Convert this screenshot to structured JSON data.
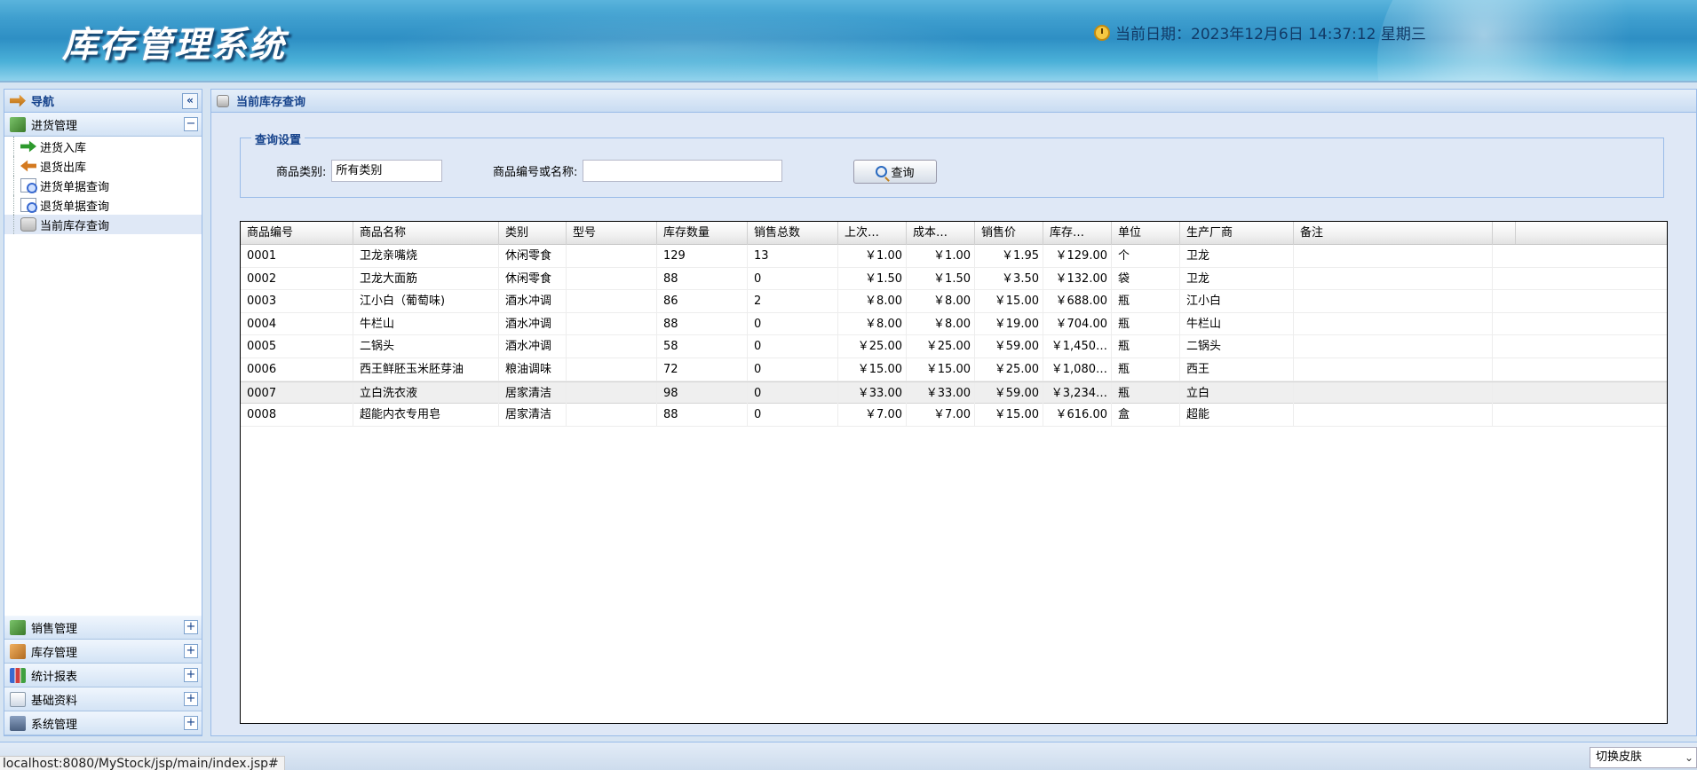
{
  "header": {
    "app_title": "库存管理系统",
    "datetime": "当前日期：2023年12月6日 14:37:12 星期三",
    "clock_icon": "clock-icon"
  },
  "nav": {
    "title": "导航",
    "collapse_glyph": "«",
    "expanded_group": {
      "label": "进货管理",
      "toggle": "−",
      "items": [
        {
          "label": "进货入库",
          "icon": "stock-in-icon"
        },
        {
          "label": "退货出库",
          "icon": "stock-out-icon"
        },
        {
          "label": "进货单据查询",
          "icon": "document-search-icon"
        },
        {
          "label": "退货单据查询",
          "icon": "document-search-icon"
        },
        {
          "label": "当前库存查询",
          "icon": "database-icon",
          "active": true
        }
      ]
    },
    "groups": [
      {
        "label": "销售管理",
        "toggle": "+"
      },
      {
        "label": "库存管理",
        "toggle": "+"
      },
      {
        "label": "统计报表",
        "toggle": "+"
      },
      {
        "label": "基础资料",
        "toggle": "+"
      },
      {
        "label": "系统管理",
        "toggle": "+"
      }
    ]
  },
  "main": {
    "title": "当前库存查询",
    "query": {
      "legend": "查询设置",
      "category_label": "商品类别:",
      "category_value": "所有类别",
      "keyword_label": "商品编号或名称:",
      "keyword_value": "",
      "button_label": "查询"
    },
    "grid": {
      "columns": [
        "商品编号",
        "商品名称",
        "类别",
        "型号",
        "库存数量",
        "销售总数",
        "上次…",
        "成本…",
        "销售价",
        "库存…",
        "单位",
        "生产厂商",
        "备注"
      ],
      "rows": [
        [
          "0001",
          "卫龙亲嘴烧",
          "休闲零食",
          "",
          "129",
          "13",
          "￥1.00",
          "￥1.00",
          "￥1.95",
          "￥129.00",
          "个",
          "卫龙",
          ""
        ],
        [
          "0002",
          "卫龙大面筋",
          "休闲零食",
          "",
          "88",
          "0",
          "￥1.50",
          "￥1.50",
          "￥3.50",
          "￥132.00",
          "袋",
          "卫龙",
          ""
        ],
        [
          "0003",
          "江小白（葡萄味)",
          "酒水冲调",
          "",
          "86",
          "2",
          "￥8.00",
          "￥8.00",
          "￥15.00",
          "￥688.00",
          "瓶",
          "江小白",
          ""
        ],
        [
          "0004",
          "牛栏山",
          "酒水冲调",
          "",
          "88",
          "0",
          "￥8.00",
          "￥8.00",
          "￥19.00",
          "￥704.00",
          "瓶",
          "牛栏山",
          ""
        ],
        [
          "0005",
          "二锅头",
          "酒水冲调",
          "",
          "58",
          "0",
          "￥25.00",
          "￥25.00",
          "￥59.00",
          "￥1,450…",
          "瓶",
          "二锅头",
          ""
        ],
        [
          "0006",
          "西王鲜胚玉米胚芽油",
          "粮油调味",
          "",
          "72",
          "0",
          "￥15.00",
          "￥15.00",
          "￥25.00",
          "￥1,080…",
          "瓶",
          "西王",
          ""
        ],
        [
          "0007",
          "立白洗衣液",
          "居家清洁",
          "",
          "98",
          "0",
          "￥33.00",
          "￥33.00",
          "￥59.00",
          "￥3,234…",
          "瓶",
          "立白",
          ""
        ],
        [
          "0008",
          "超能内衣专用皂",
          "居家清洁",
          "",
          "88",
          "0",
          "￥7.00",
          "￥7.00",
          "￥15.00",
          "￥616.00",
          "盒",
          "超能",
          ""
        ]
      ],
      "highlighted_row": 6
    }
  },
  "statusbar": {
    "url": "localhost:8080/MyStock/jsp/main/index.jsp#",
    "skin_label": "切换皮肤",
    "skin_dropdown_glyph": "⌄"
  }
}
